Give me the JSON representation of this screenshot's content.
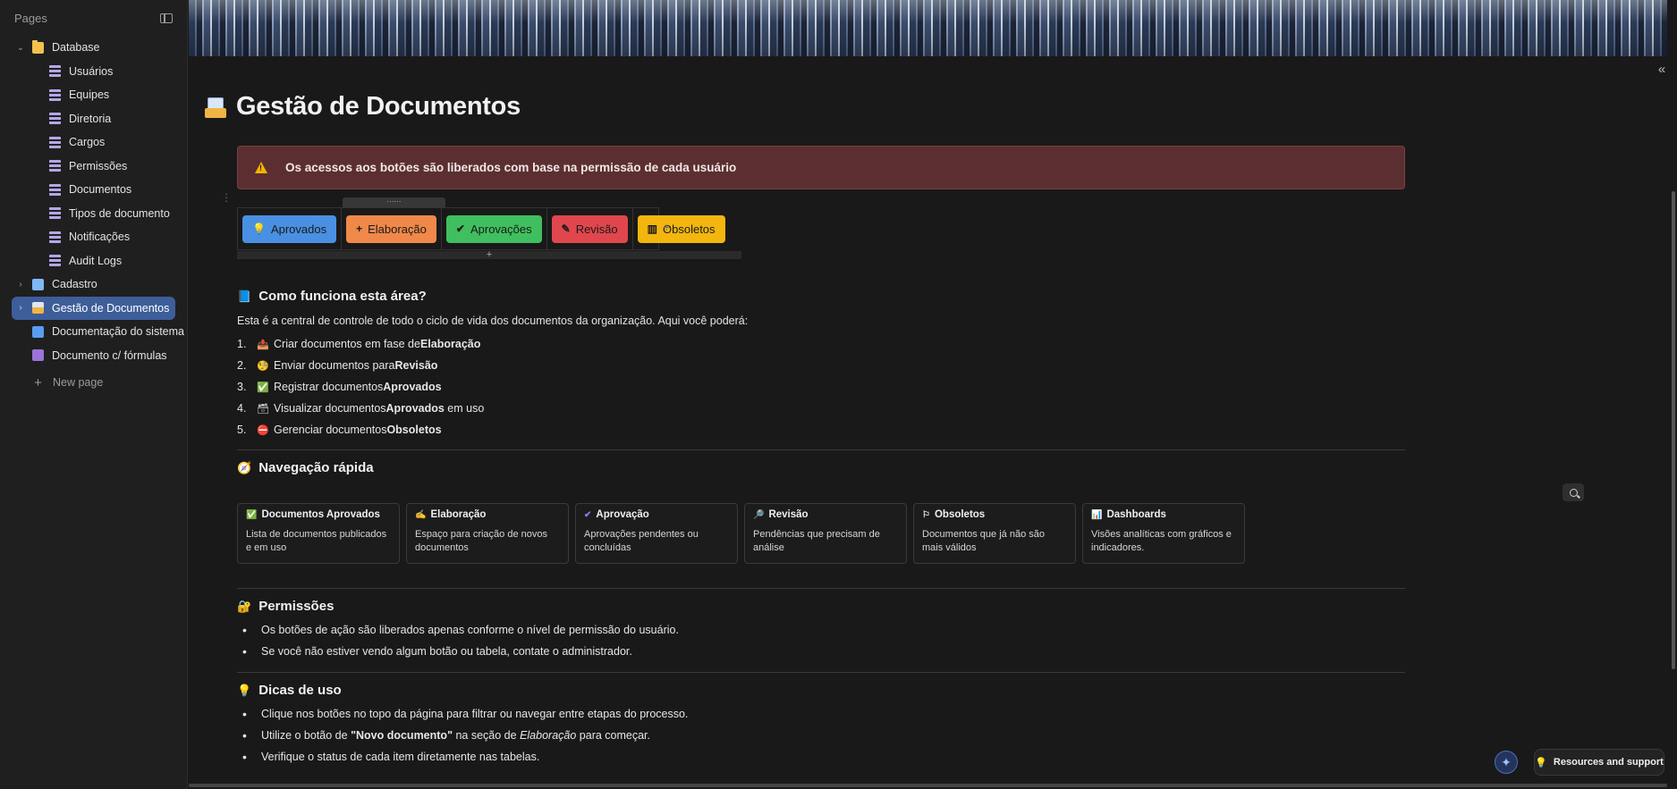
{
  "sidebar": {
    "header": "Pages",
    "database": {
      "label": "Database",
      "children": [
        "Usuários",
        "Equipes",
        "Diretoria",
        "Cargos",
        "Permissões",
        "Documentos",
        "Tipos de documento",
        "Notificações",
        "Audit Logs"
      ]
    },
    "pages": [
      {
        "label": "Cadastro",
        "icon": "document-icon"
      },
      {
        "label": "Gestão de Documentos",
        "icon": "inbox-tray-icon",
        "active": true
      },
      {
        "label": "Documentação do sistema",
        "icon": "document-icon"
      },
      {
        "label": "Documento c/ fórmulas",
        "icon": "document-icon"
      }
    ],
    "new_page": "New page"
  },
  "page": {
    "title": "Gestão de Documentos",
    "callout": "Os acessos aos botões são liberados com base na permissão de cada usuário",
    "buttons": [
      {
        "label": "Aprovados",
        "icon": "💡",
        "color": "#4a90e2"
      },
      {
        "label": "Elaboração",
        "icon": "+",
        "color": "#f0884a"
      },
      {
        "label": "Aprovações",
        "icon": "✔",
        "color": "#3fbf5f"
      },
      {
        "label": "Revisão",
        "icon": "✎",
        "color": "#e0474c"
      },
      {
        "label": "Obsoletos",
        "icon": "▥",
        "color": "#f2b60f"
      }
    ],
    "how": {
      "title": "Como funciona esta área?",
      "intro": "Esta é a central de controle de todo o ciclo de vida dos documentos da organização. Aqui você poderá:",
      "items": [
        {
          "num": "1.",
          "icon": "📤",
          "text": "Criar documentos em fase de ",
          "bold": "Elaboração",
          "after": ""
        },
        {
          "num": "2.",
          "icon": "🧐",
          "text": "Enviar documentos para ",
          "bold": "Revisão",
          "after": ""
        },
        {
          "num": "3.",
          "icon": "✅",
          "text": "Registrar documentos ",
          "bold": "Aprovados",
          "after": ""
        },
        {
          "num": "4.",
          "icon": "🗃",
          "text": "Visualizar documentos ",
          "bold": "Aprovados",
          "after": " em uso"
        },
        {
          "num": "5.",
          "icon": "⛔",
          "text": "Gerenciar documentos ",
          "bold": "Obsoletos",
          "after": ""
        }
      ]
    },
    "nav": {
      "title": "Navegação rápida",
      "cards": [
        {
          "title": "Documentos Aprovados",
          "icon": "✅",
          "desc": "Lista de documentos publicados e em uso"
        },
        {
          "title": "Elaboração",
          "icon": "✍",
          "desc": "Espaço para criação de novos documentos"
        },
        {
          "title": "Aprovação",
          "icon": "✔",
          "desc": "Aprovações pendentes ou concluídas"
        },
        {
          "title": "Revisão",
          "icon": "🔎",
          "desc": "Pendências que precisam de análise"
        },
        {
          "title": "Obsoletos",
          "icon": "⚐",
          "desc": "Documentos que já não são mais válidos"
        },
        {
          "title": "Dashboards",
          "icon": "📊",
          "desc": "Visões analíticas com gráficos e indicadores."
        }
      ]
    },
    "perms": {
      "title": "Permissões",
      "items": [
        "Os botões de ação são liberados apenas conforme o nível de permissão do usuário.",
        "Se você não estiver vendo algum botão ou tabela, contate o administrador."
      ]
    },
    "tips": {
      "title": "Dicas de uso",
      "items": [
        {
          "pre": "Clique nos botões no topo da página para filtrar ou navegar entre etapas do processo.",
          "bold": "",
          "mid": "",
          "ital": "",
          "post": ""
        },
        {
          "pre": "Utilize o botão de ",
          "bold": "\"Novo documento\"",
          "mid": " na seção de ",
          "ital": "Elaboração",
          "post": " para começar."
        },
        {
          "pre": "Verifique o status de cada item diretamente nas tabelas.",
          "bold": "",
          "mid": "",
          "ital": "",
          "post": ""
        }
      ]
    }
  },
  "footer": {
    "resources": "Resources and support"
  }
}
